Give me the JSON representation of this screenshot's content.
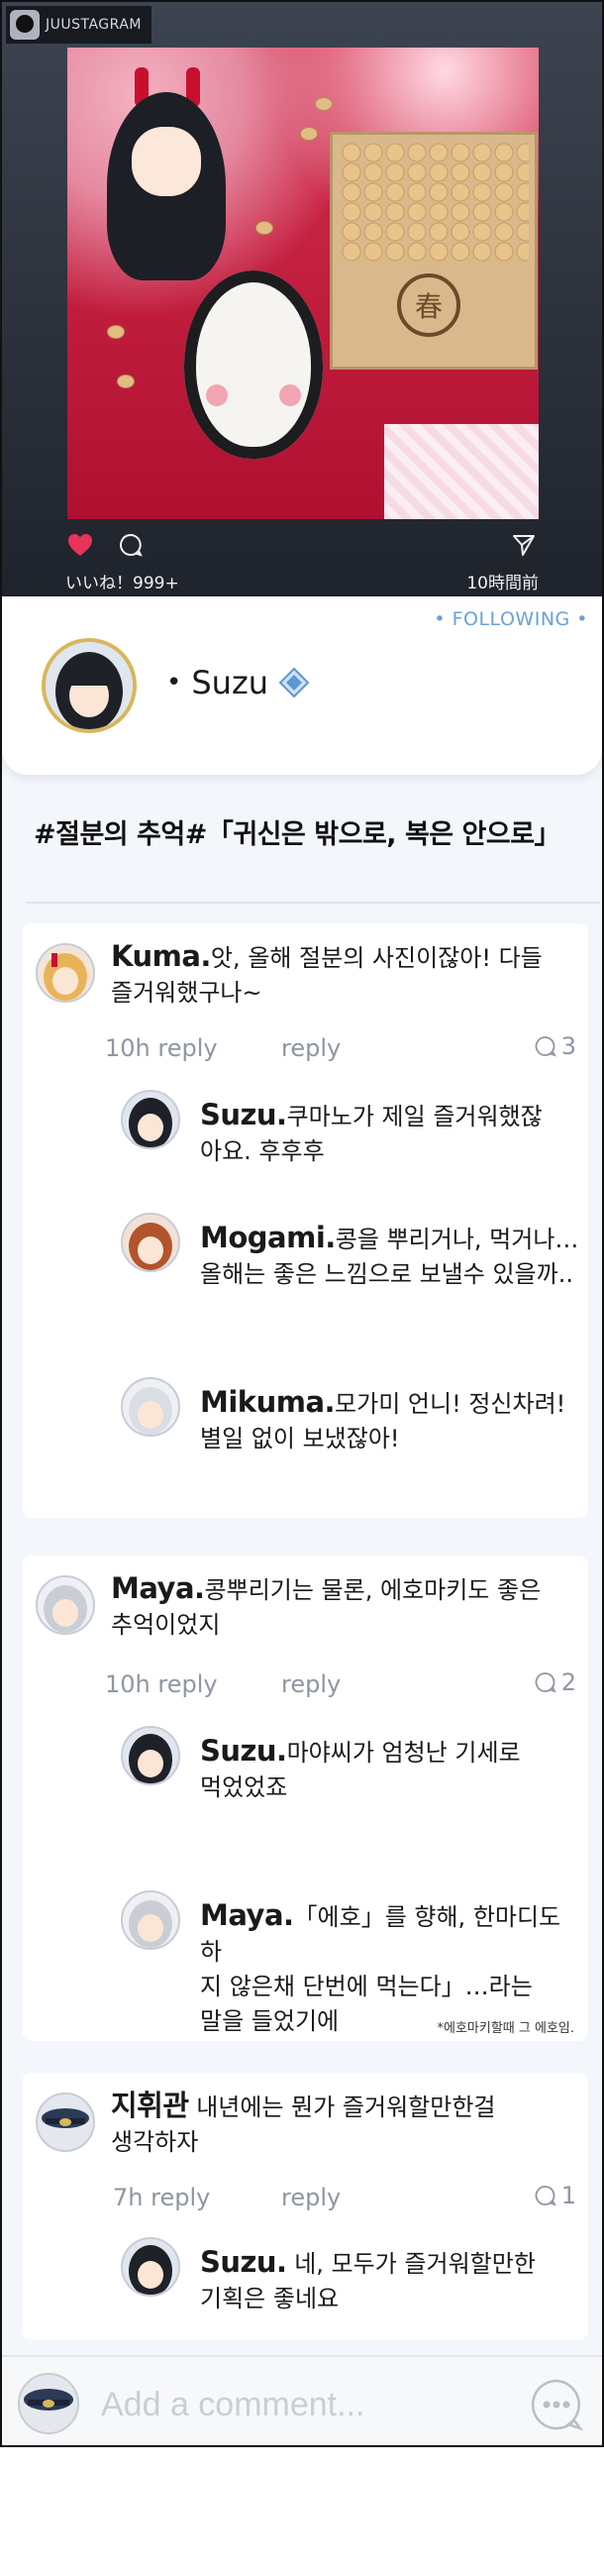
{
  "app": {
    "badge_label": "JUUSTAGRAM"
  },
  "post": {
    "likes_text": "いいね！999+",
    "time_text": "10時間前",
    "stamp_char": "春"
  },
  "profile": {
    "following_label": "• FOLLOWING •",
    "bullet": "•",
    "name": "Suzu"
  },
  "caption": "#절분의 추억#「귀신은 밖으로, 복은 안으로」",
  "threads": [
    {
      "comment": {
        "user": "Kuma.",
        "text_line1": "앗, 올해 절분의 사진이잖아! 다들",
        "text_line2": "즐거워했구나~"
      },
      "time": "10h reply",
      "reply": "reply",
      "count": "3",
      "replies": [
        {
          "user": "Suzu.",
          "line1": "쿠마노가 제일 즐거워했잖",
          "line2": "아요. 후후후"
        },
        {
          "user": "Mogami.",
          "line1": "콩을 뿌리거나, 먹거나…",
          "line2": "올해는 좋은 느낌으로 보낼수 있을까.."
        },
        {
          "user": "Mikuma.",
          "line1": "모가미 언니! 정신차려!",
          "line2": "별일 없이 보냈잖아!"
        }
      ]
    },
    {
      "comment": {
        "user": "Maya.",
        "text_line1": "콩뿌리기는 물론, 에호마키도 좋은",
        "text_line2": "추억이었지"
      },
      "time": "10h reply",
      "reply": "reply",
      "count": "2",
      "replies": [
        {
          "user": "Suzu.",
          "line1": "마야씨가 엄청난 기세로",
          "line2": "먹었었죠"
        },
        {
          "user": "Maya.",
          "line1": "「에호」를 향해, 한마디도 하",
          "line2": "지 않은채 단번에 먹는다」…라는",
          "line3": "말을 들었기에"
        }
      ],
      "footnote": "*에호마키할때 그 에호임."
    },
    {
      "comment": {
        "user": "지휘관",
        "text_line1": "내년에는 뭔가 즐거워할만한걸",
        "text_line2": "생각하자"
      },
      "time": "7h reply",
      "reply": "reply",
      "count": "1",
      "replies": [
        {
          "user": "Suzu.",
          "line1": "네, 모두가 즐거워할만한",
          "line2": "기획은 좋네요"
        }
      ]
    }
  ],
  "composer": {
    "placeholder": "Add a comment..."
  },
  "colors": {
    "accent": "#6aa1d8",
    "meta": "#8f96a1",
    "like": "#e8335a"
  }
}
